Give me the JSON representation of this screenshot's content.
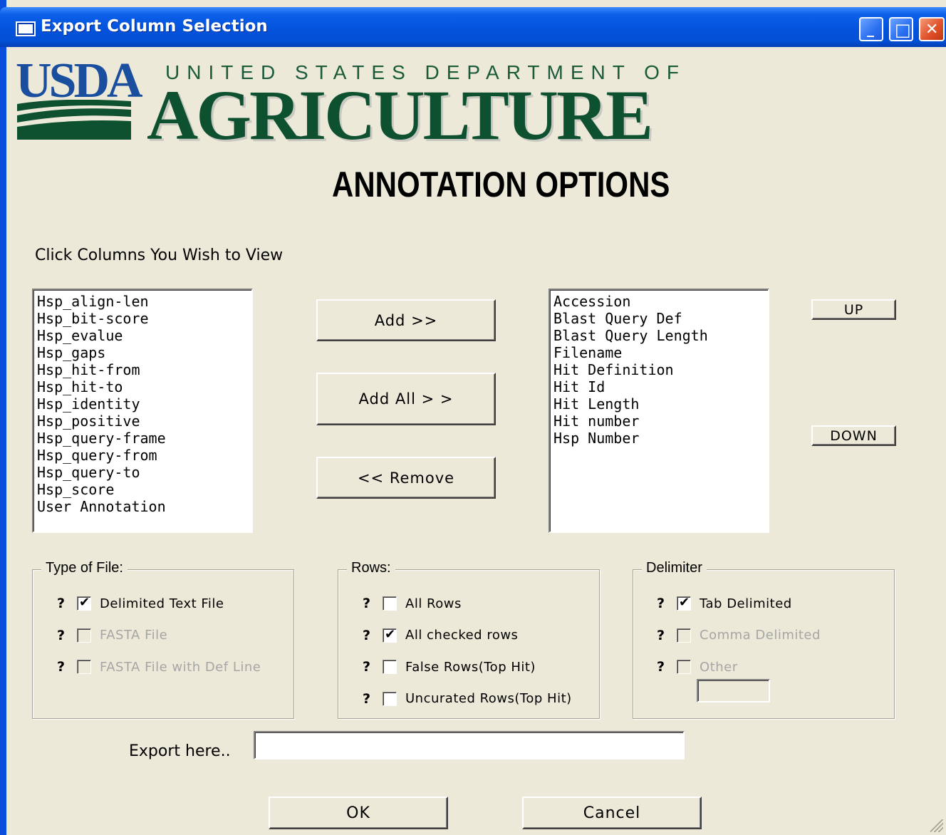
{
  "window": {
    "title": "Export Column Selection",
    "minimize_glyph": "_",
    "maximize_glyph": "□",
    "close_glyph": "✕"
  },
  "logo": {
    "usda": "USDA",
    "department_line": "UNITED STATES DEPARTMENT OF",
    "agriculture": "AGRICULTURE"
  },
  "heading": "ANNOTATION OPTIONS",
  "instruction": "Click Columns You Wish to View",
  "available_columns": [
    "Hsp_align-len",
    "Hsp_bit-score",
    "Hsp_evalue",
    "Hsp_gaps",
    "Hsp_hit-from",
    "Hsp_hit-to",
    "Hsp_identity",
    "Hsp_positive",
    "Hsp_query-frame",
    "Hsp_query-from",
    "Hsp_query-to",
    "Hsp_score",
    "User Annotation"
  ],
  "selected_columns": [
    "Accession",
    "Blast Query Def",
    "Blast Query Length",
    "Filename",
    "Hit Definition",
    "Hit Id",
    "Hit Length",
    "Hit number",
    "Hsp Number"
  ],
  "buttons": {
    "add": "Add >>",
    "add_all": "Add All   > >",
    "remove": "<< Remove",
    "up": "UP",
    "down": "DOWN",
    "ok": "OK",
    "cancel": "Cancel"
  },
  "type_of_file": {
    "title": "Type of File:",
    "help": "?",
    "options": [
      {
        "label": "Delimited Text File",
        "checked": true,
        "enabled": true
      },
      {
        "label": "FASTA File",
        "checked": false,
        "enabled": false
      },
      {
        "label": "FASTA File with Def Line",
        "checked": false,
        "enabled": false
      }
    ]
  },
  "rows": {
    "title": "Rows:",
    "help": "?",
    "options": [
      {
        "label": "All Rows",
        "checked": false,
        "enabled": true
      },
      {
        "label": "All checked rows",
        "checked": true,
        "enabled": true
      },
      {
        "label": "False Rows(Top Hit)",
        "checked": false,
        "enabled": true
      },
      {
        "label": "Uncurated Rows(Top Hit)",
        "checked": false,
        "enabled": true
      }
    ]
  },
  "delimiter": {
    "title": "Delimiter",
    "help": "?",
    "options": [
      {
        "label": "Tab Delimited",
        "checked": true,
        "enabled": true
      },
      {
        "label": "Comma Delimited",
        "checked": false,
        "enabled": false
      },
      {
        "label": "Other",
        "checked": false,
        "enabled": false
      }
    ],
    "other_value": ""
  },
  "export": {
    "label": "Export here..",
    "value": ""
  },
  "check_glyph": "✔",
  "colors": {
    "titlebar": "#0453dd",
    "dialog_bg": "#ece9d8",
    "usda_blue": "#1a4e9e",
    "usda_green": "#0e5130"
  }
}
